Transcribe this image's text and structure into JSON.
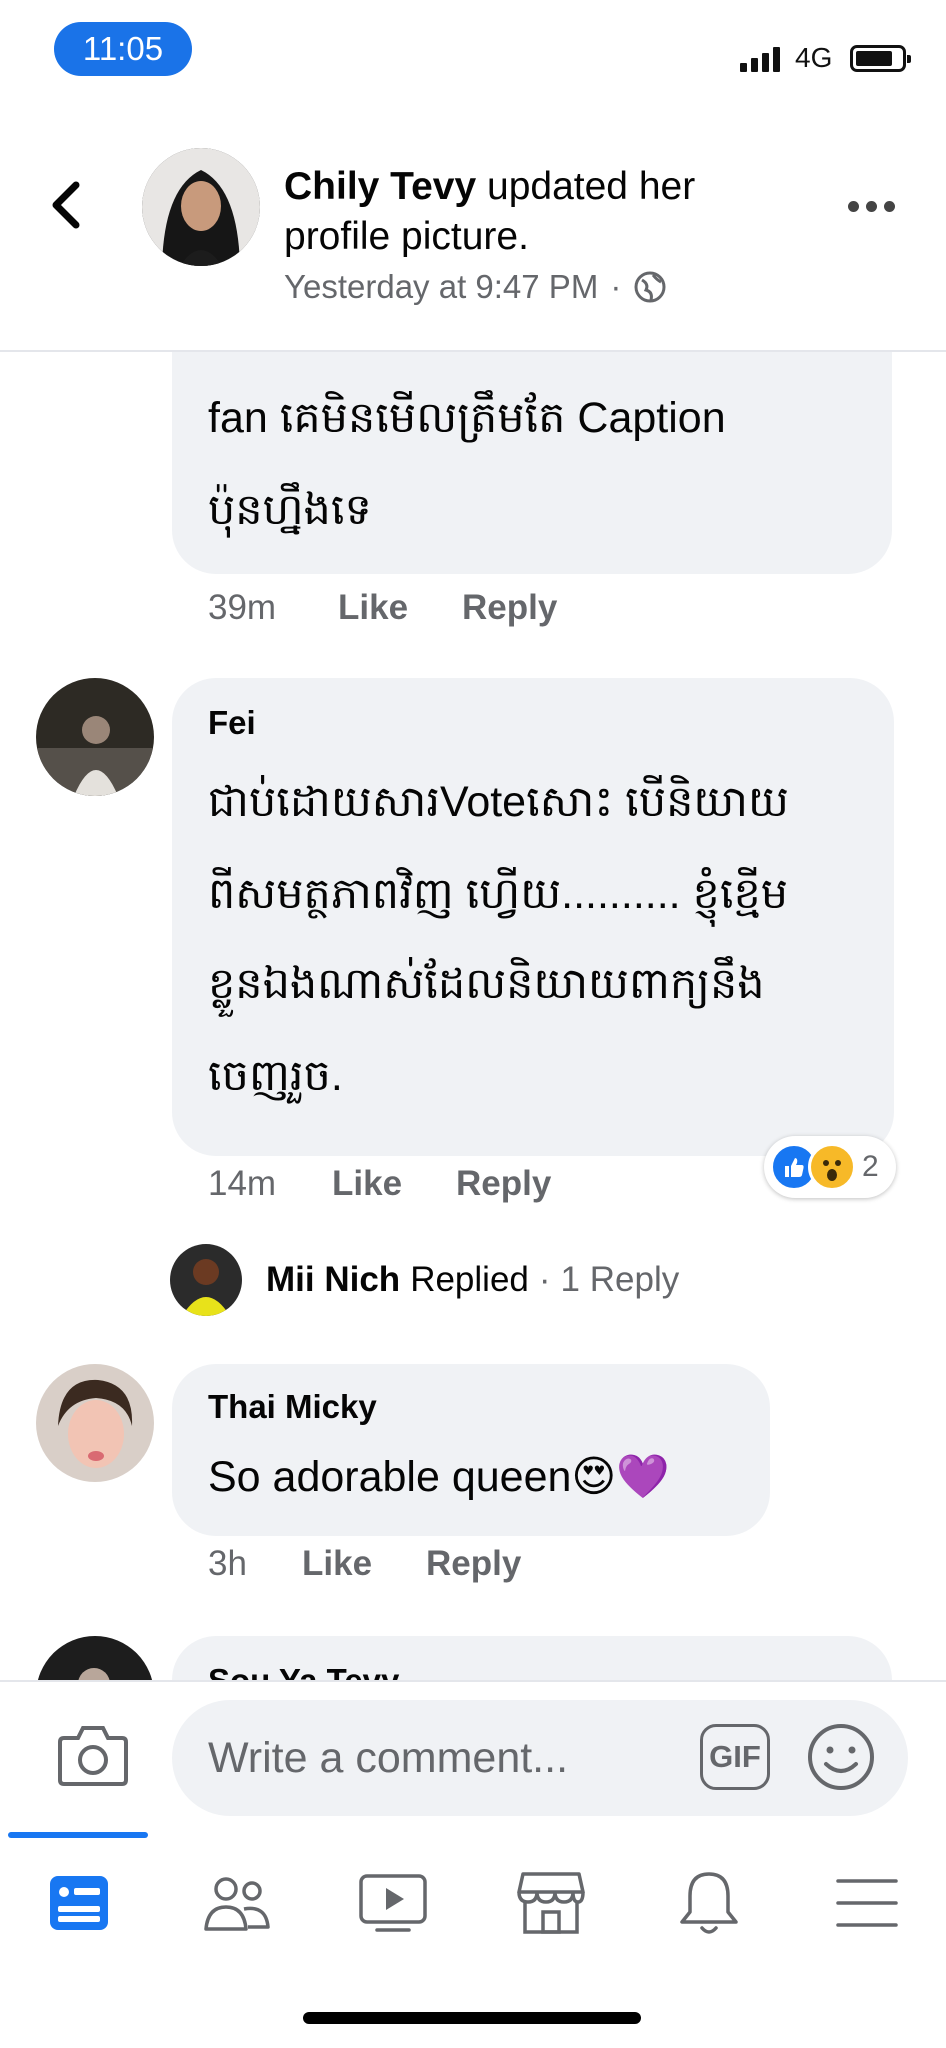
{
  "status_bar": {
    "time": "11:05",
    "network": "4G"
  },
  "post": {
    "author": "Chily Tevy",
    "action": " updated her profile picture.",
    "timestamp": "Yesterday at 9:47 PM",
    "separator": "·",
    "privacy_icon": "globe-icon"
  },
  "comments": [
    {
      "author": "",
      "lines": [
        "fan គេមិនមើលត្រឹមតែ Caption",
        "ប៉ុនហ្នឹងទេ"
      ],
      "time": "39m",
      "like": "Like",
      "reply": "Reply"
    },
    {
      "author": "Fei",
      "lines": [
        "ជាប់ដោយសារVoteសោះ បើនិយាយ",
        "ពីសមត្ថភាពវិញ ហ្វេីយ.......... ខ្ញុំខ្មើម",
        "ខ្លួនឯងណាស់ដែលនិយាយពាក្យនឹង",
        "ចេញរួច."
      ],
      "time": "14m",
      "like": "Like",
      "reply": "Reply",
      "reactions": {
        "icons": [
          "like-reaction-icon",
          "wow-reaction-icon"
        ],
        "count": "2"
      },
      "replies_row": {
        "name": "Mii Nich",
        "action": "Replied",
        "separator": "·",
        "count": "1 Reply"
      }
    },
    {
      "author": "Thai Micky",
      "text": "So adorable queen😍💜",
      "time": "3h",
      "like": "Like",
      "reply": "Reply"
    },
    {
      "author": "Sou Ya Tevy"
    }
  ],
  "composer": {
    "placeholder": "Write a comment...",
    "gif_label": "GIF"
  },
  "tab_bar": {
    "active": "news-feed",
    "tabs": [
      "news-feed-icon",
      "friends-icon",
      "watch-icon",
      "marketplace-icon",
      "notifications-icon",
      "menu-icon"
    ]
  },
  "colors": {
    "accent": "#1877f2",
    "bubble": "#f0f2f5",
    "secondary_text": "#65676b",
    "time_pill": "#1a73e8"
  }
}
